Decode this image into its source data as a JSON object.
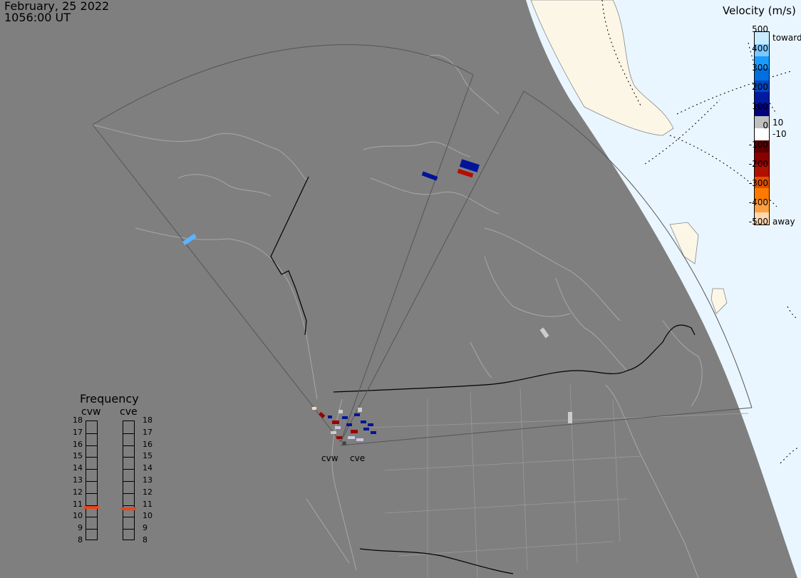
{
  "header": {
    "date": "February, 25 2022",
    "time": "1056:00 UT"
  },
  "colorbar": {
    "title": "Velocity (m/s)",
    "ticks": [
      "500",
      "400",
      "300",
      "200",
      "100",
      "0",
      "-100",
      "-200",
      "-300",
      "-400",
      "-500"
    ],
    "near_zero_pos": "10",
    "near_zero_neg": "-10",
    "label_top": "toward",
    "label_bottom": "away",
    "colors": [
      "#ffd8b0",
      "#ffa040",
      "#ff7a00",
      "#e05000",
      "#b01000",
      "#8a0000",
      "#5a0000",
      "#ffffff",
      "#bfbfbf",
      "#000080",
      "#001aa0",
      "#0047c0",
      "#0070e0",
      "#1a9cff",
      "#7cc8ff",
      "#c8ecff"
    ]
  },
  "frequency": {
    "title": "Frequency",
    "radars": [
      "cvw",
      "cve"
    ],
    "scale": [
      "18",
      "17",
      "16",
      "15",
      "14",
      "13",
      "12",
      "11",
      "10",
      "9",
      "8"
    ],
    "values_mhz": [
      10.8,
      10.7
    ],
    "marker_color": "#e8461e"
  },
  "radar_sites": [
    "cvw",
    "cve"
  ],
  "map_colors": {
    "background": "#7f7f7f",
    "land_outline": "#a8a8a8",
    "ocean_night_edge": "#eaf6ff",
    "land_day": "#fbf6e6",
    "border_line": "#000000"
  }
}
